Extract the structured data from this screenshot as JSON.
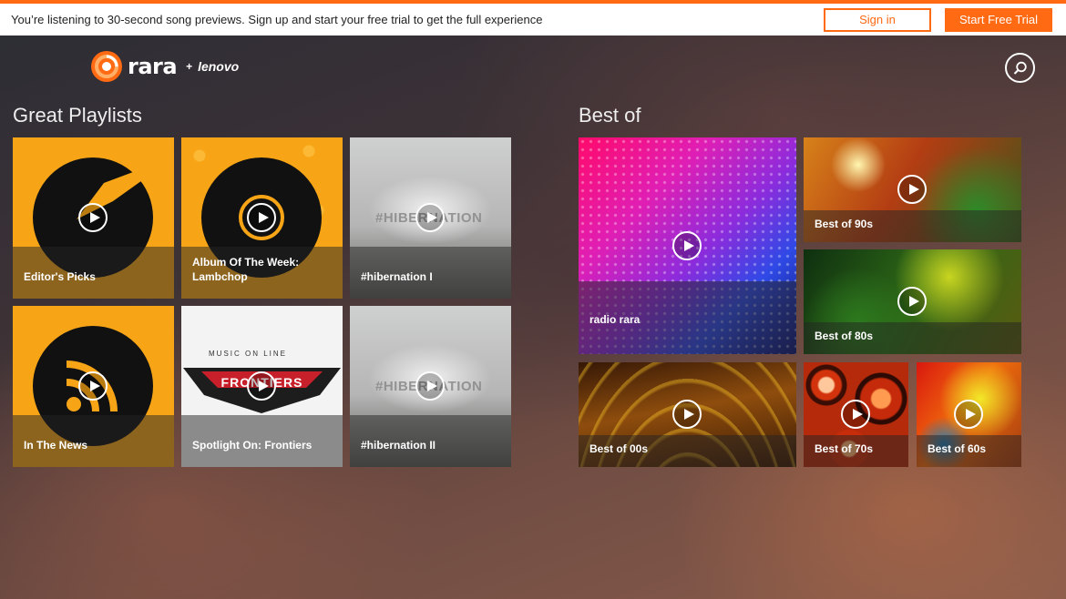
{
  "banner": {
    "message": "You’re listening to 30-second song previews. Sign up and start your free trial to get the full experience",
    "sign_in_label": "Sign in",
    "trial_label": "Start Free Trial"
  },
  "brand": {
    "name": "rara",
    "partner": "lenovo",
    "plus": "+",
    "accent_color": "#ff6a13"
  },
  "header": {
    "search_icon": "search-icon"
  },
  "playlists": {
    "title": "Great Playlists",
    "items": [
      {
        "label": "Editor's Picks"
      },
      {
        "label": "Album Of The Week: Lambchop"
      },
      {
        "label": "#hibernation I"
      },
      {
        "label": "In The News"
      },
      {
        "label": "Spotlight On: Frontiers"
      },
      {
        "label": "#hibernation II"
      }
    ]
  },
  "best_of": {
    "title": "Best of",
    "items": [
      {
        "label": "radio rara"
      },
      {
        "label": "Best of 90s"
      },
      {
        "label": "Best of 80s"
      },
      {
        "label": "Best of 00s"
      },
      {
        "label": "Best of 70s"
      },
      {
        "label": "Best of 60s"
      }
    ]
  },
  "artwork_text": {
    "hibernation": "#HIBERNATION",
    "frontiers": "FRONTIERS",
    "music_on_line": "MUSIC ON LINE"
  }
}
